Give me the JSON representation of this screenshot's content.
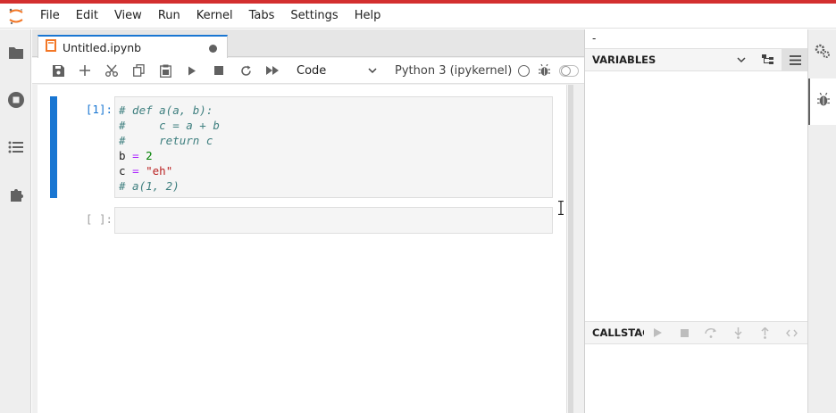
{
  "menubar": {
    "items": [
      "File",
      "Edit",
      "View",
      "Run",
      "Kernel",
      "Tabs",
      "Settings",
      "Help"
    ]
  },
  "leftbar": {
    "icons": [
      "folder-icon",
      "running-icon",
      "toc-icon",
      "extension-icon"
    ]
  },
  "tab": {
    "title": "Untitled.ipynb",
    "unsaved": true
  },
  "toolbar": {
    "cell_type": "Code",
    "kernel_name": "Python 3 (ipykernel)"
  },
  "cells": [
    {
      "prompt": "[1]:",
      "lines": [
        [
          {
            "t": "# def a(a, b):",
            "c": "comment"
          }
        ],
        [
          {
            "t": "#     c = a + b",
            "c": "comment"
          }
        ],
        [
          {
            "t": "#     return c",
            "c": "comment"
          }
        ],
        [
          {
            "t": "b ",
            "c": "var"
          },
          {
            "t": "=",
            "c": "op"
          },
          {
            "t": " ",
            "c": "var"
          },
          {
            "t": "2",
            "c": "num"
          }
        ],
        [
          {
            "t": "c ",
            "c": "var"
          },
          {
            "t": "=",
            "c": "op"
          },
          {
            "t": " ",
            "c": "var"
          },
          {
            "t": "\"eh\"",
            "c": "str"
          }
        ],
        [
          {
            "t": "# a(1, 2)",
            "c": "comment"
          }
        ]
      ]
    },
    {
      "prompt": "[ ]:",
      "lines": []
    }
  ],
  "debugger": {
    "top_label": "-",
    "variables_title": "VARIABLES",
    "callstack_title": "CALLSTACK"
  },
  "colors": {
    "accent": "#1976d2",
    "brand_stripe": "#d32f2f",
    "prompt_active": "#1976d2",
    "prompt_idle": "#9e9e9e"
  }
}
